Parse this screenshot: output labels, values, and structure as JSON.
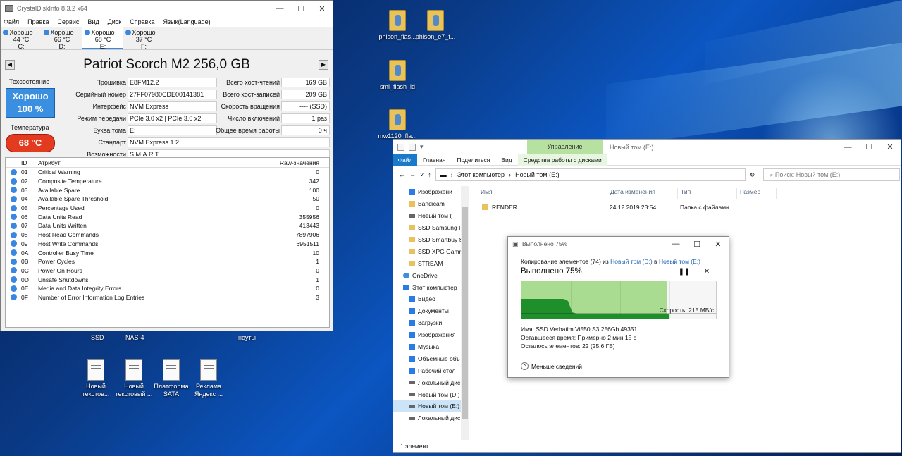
{
  "cdi": {
    "title": "CrystalDiskInfo 8.3.2 x64",
    "menu": [
      "Файл",
      "Правка",
      "Сервис",
      "Вид",
      "Диск",
      "Справка",
      "Язык(Language)"
    ],
    "drives": [
      {
        "status": "Хорошо",
        "temp": "44 °C",
        "letter": "C:"
      },
      {
        "status": "Хорошо",
        "temp": "66 °C",
        "letter": "D:"
      },
      {
        "status": "Хорошо",
        "temp": "68 °C",
        "letter": "E:"
      },
      {
        "status": "Хорошо",
        "temp": "37 °C",
        "letter": "F:"
      }
    ],
    "model": "Patriot Scorch M2 256,0 GB",
    "health_label": "Техсостояние",
    "health_value": "Хорошо",
    "health_percent": "100 %",
    "temp_label": "Температура",
    "temp_value": "68 °C",
    "fields": {
      "firmware": {
        "label": "Прошивка",
        "value": "E8FM12.2"
      },
      "serial": {
        "label": "Серийный номер",
        "value": "27FF07980CDE00141381"
      },
      "interface": {
        "label": "Интерфейс",
        "value": "NVM Express"
      },
      "transfer": {
        "label": "Режим передачи",
        "value": "PCIe 3.0 x2 | PCIe 3.0 x2"
      },
      "letter": {
        "label": "Буква тома",
        "value": "E:"
      },
      "standard": {
        "label": "Стандарт",
        "value": "NVM Express 1.2"
      },
      "features": {
        "label": "Возможности",
        "value": "S.M.A.R.T."
      },
      "host_reads": {
        "label": "Всего хост-чтений",
        "value": "169 GB"
      },
      "host_writes": {
        "label": "Всего хост-записей",
        "value": "209 GB"
      },
      "rotation": {
        "label": "Скорость вращения",
        "value": "---- (SSD)"
      },
      "power_on_count": {
        "label": "Число включений",
        "value": "1 раз"
      },
      "power_on_hours": {
        "label": "Общее время работы",
        "value": "0 ч"
      }
    },
    "smart_headers": {
      "id": "ID",
      "attr": "Атрибут",
      "raw": "Raw-значения"
    },
    "smart": [
      {
        "id": "01",
        "attr": "Critical Warning",
        "raw": "0"
      },
      {
        "id": "02",
        "attr": "Composite Temperature",
        "raw": "342"
      },
      {
        "id": "03",
        "attr": "Available Spare",
        "raw": "100"
      },
      {
        "id": "04",
        "attr": "Available Spare Threshold",
        "raw": "50"
      },
      {
        "id": "05",
        "attr": "Percentage Used",
        "raw": "0"
      },
      {
        "id": "06",
        "attr": "Data Units Read",
        "raw": "355956"
      },
      {
        "id": "07",
        "attr": "Data Units Written",
        "raw": "413443"
      },
      {
        "id": "08",
        "attr": "Host Read Commands",
        "raw": "7897906"
      },
      {
        "id": "09",
        "attr": "Host Write Commands",
        "raw": "6951511"
      },
      {
        "id": "0A",
        "attr": "Controller Busy Time",
        "raw": "10"
      },
      {
        "id": "0B",
        "attr": "Power Cycles",
        "raw": "1"
      },
      {
        "id": "0C",
        "attr": "Power On Hours",
        "raw": "0"
      },
      {
        "id": "0D",
        "attr": "Unsafe Shutdowns",
        "raw": "1"
      },
      {
        "id": "0E",
        "attr": "Media and Data Integrity Errors",
        "raw": "0"
      },
      {
        "id": "0F",
        "attr": "Number of Error Information Log Entries",
        "raw": "3"
      }
    ]
  },
  "desktop": {
    "icons": [
      "phison_flas...",
      "phison_e7_f...",
      "smi_flash_id",
      "mw1120_fla..."
    ],
    "labels": [
      "SSD",
      "NAS-4",
      "ноуты"
    ],
    "docs": [
      {
        "l1": "Новый",
        "l2": "текстов..."
      },
      {
        "l1": "Новый",
        "l2": "текстовый ..."
      },
      {
        "l1": "Платформа",
        "l2": "SATA"
      },
      {
        "l1": "Реклама",
        "l2": "Яндекс ..."
      }
    ]
  },
  "explorer": {
    "title": "Новый том (E:)",
    "context_tab": "Управление",
    "tabs": [
      "Файл",
      "Главная",
      "Поделиться",
      "Вид"
    ],
    "context_sub": "Средства работы с дисками",
    "path": [
      "Этот компьютер",
      "Новый том (E:)"
    ],
    "search_placeholder": "Поиск: Новый том (E:)",
    "columns": [
      "Имя",
      "Дата изменения",
      "Тип",
      "Размер"
    ],
    "file": {
      "name": "RENDER",
      "date": "24.12.2019 23:54",
      "type": "Папка с файлами"
    },
    "nav": [
      {
        "label": "Изображени",
        "icon": "blue"
      },
      {
        "label": "Bandicam",
        "icon": "folder"
      },
      {
        "label": "Новый том (",
        "icon": "drive"
      },
      {
        "label": "SSD Samsung PM",
        "icon": "folder"
      },
      {
        "label": "SSD Smartbuy St",
        "icon": "folder"
      },
      {
        "label": "SSD XPG Gammi",
        "icon": "folder"
      },
      {
        "label": "STREAM",
        "icon": "folder"
      },
      {
        "label": "OneDrive",
        "icon": "cloud"
      },
      {
        "label": "Этот компьютер",
        "icon": "blue"
      },
      {
        "label": "Видео",
        "icon": "blue"
      },
      {
        "label": "Документы",
        "icon": "blue"
      },
      {
        "label": "Загрузки",
        "icon": "blue"
      },
      {
        "label": "Изображения",
        "icon": "blue"
      },
      {
        "label": "Музыка",
        "icon": "blue"
      },
      {
        "label": "Объемные объ",
        "icon": "blue"
      },
      {
        "label": "Рабочий стол",
        "icon": "blue"
      },
      {
        "label": "Локальный дис",
        "icon": "drive"
      },
      {
        "label": "Новый том (D:)",
        "icon": "drive"
      },
      {
        "label": "Новый том (E:)",
        "icon": "drive"
      },
      {
        "label": "Локальный дис",
        "icon": "drive"
      }
    ],
    "status": "1 элемент"
  },
  "copy": {
    "title": "Выполнено 75%",
    "copying_prefix": "Копирование элементов (74) из",
    "from": "Новый том (D:)",
    "in_word": "в",
    "to": "Новый том (E:)",
    "progress_text": "Выполнено 75%",
    "progress": 0.75,
    "speed": "Скорость: 215 МБ/с",
    "name_line": "Имя:  SSD Verbatim Vi550 S3 256Gb 49351",
    "time_line": "Оставшееся время:  Примерно 2 мин 15 с",
    "items_line": "Осталось элементов:  22 (25,6 ГБ)",
    "less_details": "Меньше сведений"
  }
}
